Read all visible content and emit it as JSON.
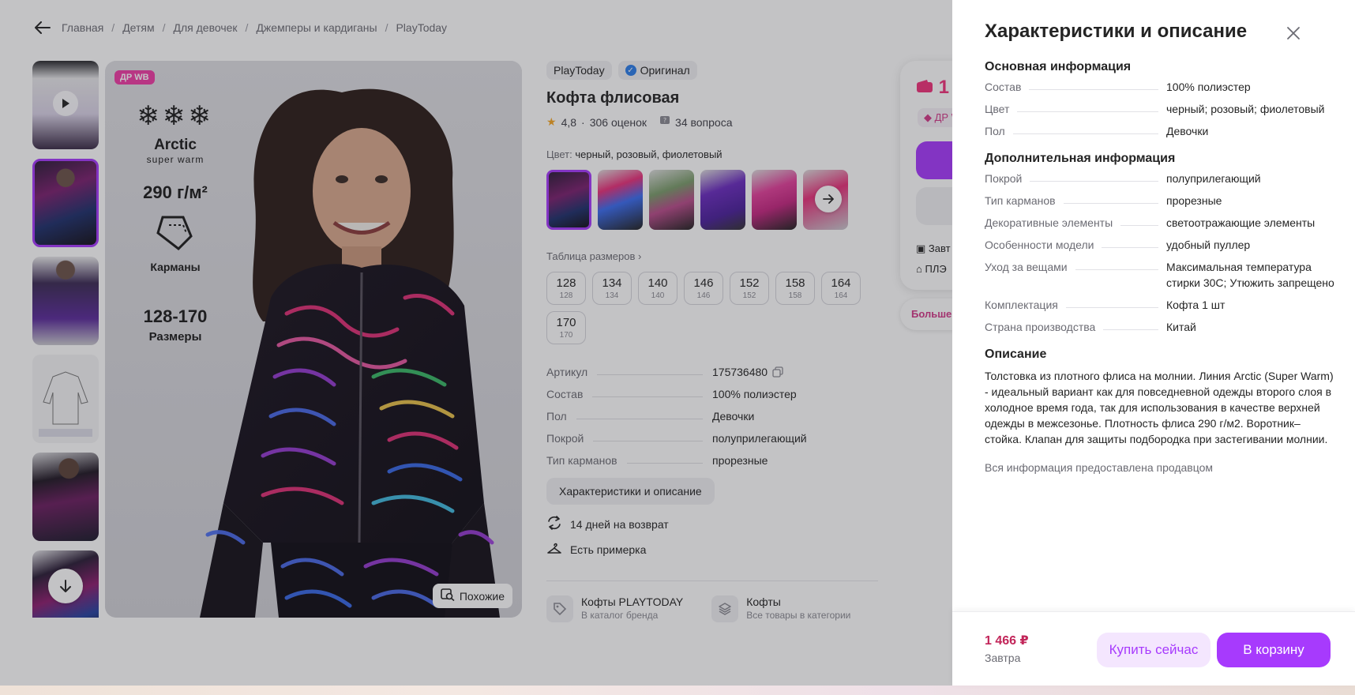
{
  "breadcrumbs": [
    "Главная",
    "Детям",
    "Для девочек",
    "Джемперы и кардиганы",
    "PlayToday"
  ],
  "gallery": {
    "badge": "ДР WB",
    "overlay": {
      "line": "Arctic",
      "subline": "super warm",
      "density": "290 г/м²",
      "pockets": "Карманы",
      "size_range": "128-170",
      "sizes_label": "Размеры"
    },
    "similar_button": "Похожие"
  },
  "product": {
    "brand": "PlayToday",
    "original_label": "Оригинал",
    "title": "Кофта флисовая",
    "rating": "4,8",
    "reviews": "306 оценок",
    "questions": "34 вопроса",
    "color_label": "Цвет:",
    "color_value": "черный, розовый, фиолетовый",
    "size_table_link": "Таблица размеров",
    "sizes": [
      {
        "ru": "128",
        "eu": "128"
      },
      {
        "ru": "134",
        "eu": "134"
      },
      {
        "ru": "140",
        "eu": "140"
      },
      {
        "ru": "146",
        "eu": "146"
      },
      {
        "ru": "152",
        "eu": "152"
      },
      {
        "ru": "158",
        "eu": "158"
      },
      {
        "ru": "164",
        "eu": "164"
      },
      {
        "ru": "170",
        "eu": "170"
      }
    ],
    "specs": [
      {
        "k": "Артикул",
        "v": "175736480"
      },
      {
        "k": "Состав",
        "v": "100% полиэстер"
      },
      {
        "k": "Пол",
        "v": "Девочки"
      },
      {
        "k": "Покрой",
        "v": "полуприлегающий"
      },
      {
        "k": "Тип карманов",
        "v": "прорезные"
      }
    ],
    "specs_button": "Характеристики и описание",
    "return_text": "14 дней на возврат",
    "fitting_text": "Есть примерка",
    "brand_link_title": "Кофты PLAYTODAY",
    "brand_link_sub": "В каталог бренда",
    "category_link_title": "Кофты",
    "category_link_sub": "Все товары в категории"
  },
  "buy_card": {
    "price_partial": "1",
    "dr_partial": "ДР W",
    "delivery_partial": "Завт",
    "seller_partial": "ПЛЭ",
    "more_partial": "Больше с"
  },
  "panel": {
    "title": "Характеристики и описание",
    "sections": [
      {
        "title": "Основная информация",
        "rows": [
          {
            "k": "Состав",
            "v": "100% полиэстер"
          },
          {
            "k": "Цвет",
            "v": "черный; розовый; фиолетовый"
          },
          {
            "k": "Пол",
            "v": "Девочки"
          }
        ]
      },
      {
        "title": "Дополнительная информация",
        "rows": [
          {
            "k": "Покрой",
            "v": "полуприлегающий"
          },
          {
            "k": "Тип карманов",
            "v": "прорезные"
          },
          {
            "k": "Декоративные элементы",
            "v": "светоотражающие элементы"
          },
          {
            "k": "Особенности модели",
            "v": "удобный пуллер"
          },
          {
            "k": "Уход за вещами",
            "v": "Максимальная температура стирки 30С; Утюжить запрещено"
          },
          {
            "k": "Комплектация",
            "v": "Кофта 1 шт"
          },
          {
            "k": "Страна производства",
            "v": "Китай"
          }
        ]
      }
    ],
    "description_title": "Описание",
    "description": "Толстовка из плотного флиса на молнии. Линия Arctic (Super Warm) - идеальный вариант как для повседневной одежды второго слоя в холодное время года, так для использования в качестве верхней одежды в межсезонье. Плотность флиса 290 г/м2. Воротник–стойка. Клапан для защиты подбородка при застегивании молнии.",
    "seller_note": "Вся информация предоставлена продавцом",
    "footer": {
      "price": "1 466 ₽",
      "delivery": "Завтра",
      "buy_now": "Купить сейчас",
      "add_to_cart": "В корзину"
    }
  },
  "colors": {
    "accent": "#a73afd",
    "price": "#c2265a",
    "overlay": "rgba(40,40,48,0.28)"
  }
}
